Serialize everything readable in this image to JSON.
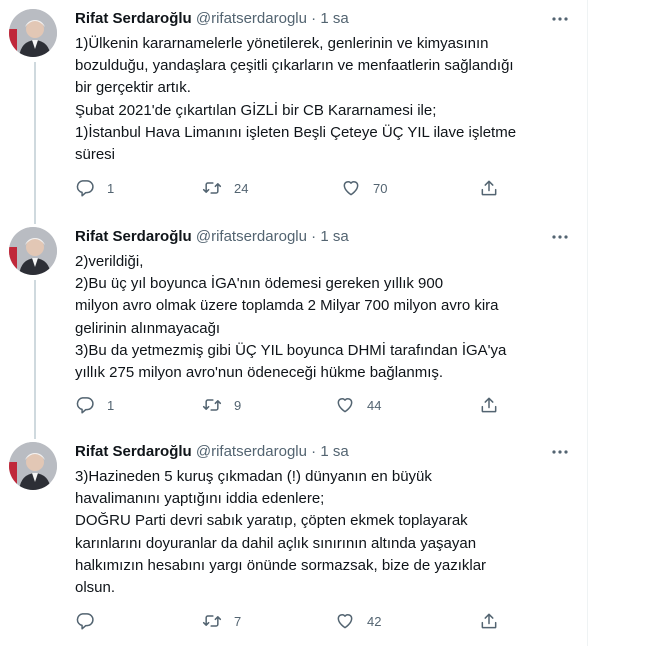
{
  "tweets": [
    {
      "author": "Rifat Serdaroğlu",
      "handle": "@rifatserdaroglu",
      "dot": "·",
      "time": "1 sa",
      "lines": [
        "1)Ülkenin kararnamelerle yönetilerek, genlerinin ve kimyasının",
        "bozulduğu, yandaşlara çeşitli çıkarların ve menfaatlerin sağlandığı",
        "bir gerçektir artık.",
        "Şubat 2021'de çıkartılan GİZLİ bir CB Kararnamesi ile;",
        "1)İstanbul Hava Limanını işleten Beşli Çeteye ÜÇ YIL ilave işletme",
        "süresi"
      ],
      "replies": "1",
      "retweets": "24",
      "likes": "70"
    },
    {
      "author": "Rifat Serdaroğlu",
      "handle": "@rifatserdaroglu",
      "dot": "·",
      "time": "1 sa",
      "lines": [
        "2)verildiği,",
        "2)Bu üç yıl boyunca İGA'nın ödemesi gereken yıllık 900",
        "milyon avro olmak üzere toplamda 2 Milyar 700 milyon avro kira",
        "gelirinin alınmayacağı",
        "3)Bu da yetmezmiş gibi ÜÇ YIL boyunca DHMİ tarafından İGA'ya",
        "yıllık 275 milyon avro'nun ödeneceği hükme bağlanmış."
      ],
      "replies": "1",
      "retweets": "9",
      "likes": "44"
    },
    {
      "author": "Rifat Serdaroğlu",
      "handle": "@rifatserdaroglu",
      "dot": "·",
      "time": "1 sa",
      "lines": [
        "3)Hazineden 5 kuruş çıkmadan (!) dünyanın en büyük",
        "havalimanını yaptığını iddia edenlere;",
        "DOĞRU Parti devri sabık yaratıp, çöpten ekmek toplayarak",
        "karınlarını doyuranlar da dahil açlık sınırının altında yaşayan",
        "halkımızın hesabını yargı önünde sormazsak, bize de yazıklar",
        "olsun."
      ],
      "replies": "",
      "retweets": "7",
      "likes": "42"
    }
  ],
  "icons": {
    "reply": "reply-icon",
    "retweet": "retweet-icon",
    "like": "heart-icon",
    "share": "share-icon",
    "more": "more-icon"
  },
  "colors": {
    "text": "#0f1419",
    "secondary": "#536471",
    "thread_line": "#cfd9de",
    "divider": "#eff3f4"
  }
}
